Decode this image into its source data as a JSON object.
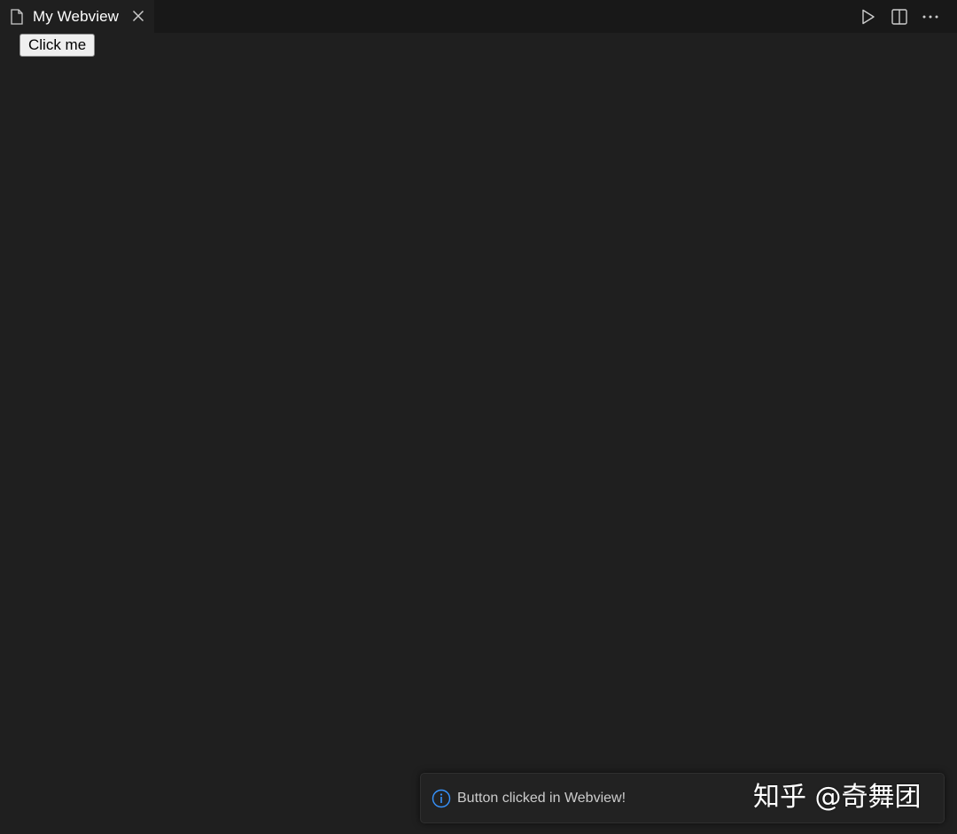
{
  "tab": {
    "title": "My Webview",
    "icon": "file-icon",
    "close_icon": "close-icon"
  },
  "editor_actions": [
    {
      "icon": "run-icon"
    },
    {
      "icon": "split-editor-icon"
    },
    {
      "icon": "more-actions-icon"
    }
  ],
  "webview": {
    "button_label": "Click me"
  },
  "notification": {
    "icon": "info-icon",
    "message": "Button clicked in Webview!"
  },
  "watermark": {
    "text": "知乎 @奇舞团"
  },
  "colors": {
    "background": "#1f1f1f",
    "tabbar": "#181818",
    "info_accent": "#3794ff"
  }
}
